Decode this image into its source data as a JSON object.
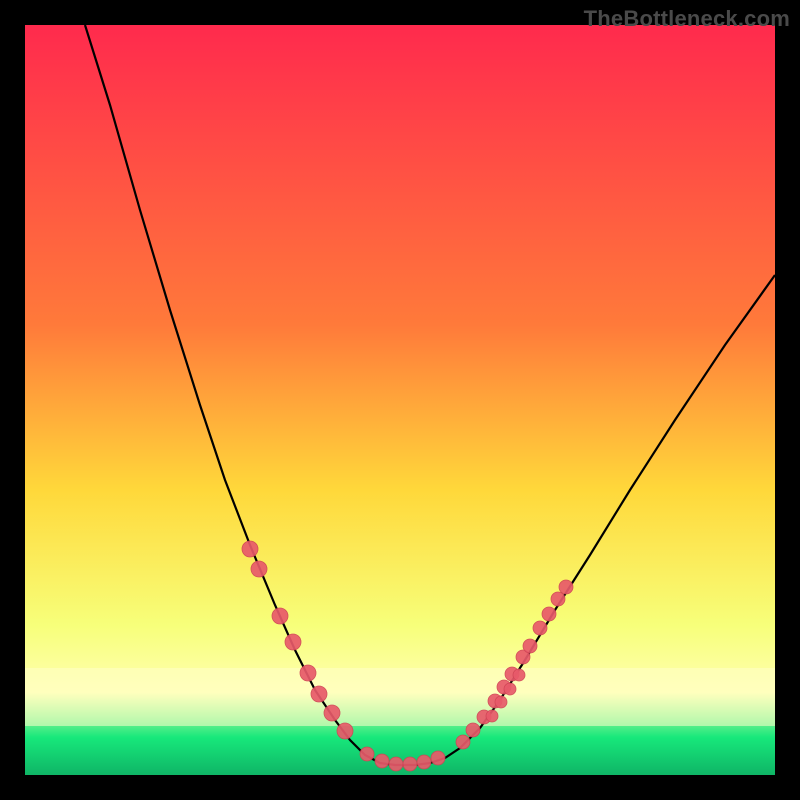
{
  "watermark": "TheBottleneck.com",
  "colors": {
    "gradient_top": "#ff2a4d",
    "gradient_upper_mid": "#ff7a3a",
    "gradient_mid": "#ffd83a",
    "gradient_lower_mid": "#f7ff7a",
    "gradient_pale_band": "#ffffb0",
    "gradient_bottom_green": "#17e87b",
    "gradient_bottom_green_dark": "#0fb566",
    "curve_stroke": "#000000",
    "marker_fill": "#e85a6a",
    "marker_stroke": "#d04455",
    "border": "#000000"
  },
  "chart_data": {
    "type": "line",
    "title": "",
    "xlabel": "",
    "ylabel": "",
    "xlim": [
      25,
      775
    ],
    "ylim": [
      775,
      25
    ],
    "curve": [
      {
        "x": 85,
        "y": 25
      },
      {
        "x": 110,
        "y": 105
      },
      {
        "x": 140,
        "y": 210
      },
      {
        "x": 170,
        "y": 310
      },
      {
        "x": 200,
        "y": 405
      },
      {
        "x": 225,
        "y": 480
      },
      {
        "x": 250,
        "y": 545
      },
      {
        "x": 275,
        "y": 605
      },
      {
        "x": 295,
        "y": 650
      },
      {
        "x": 315,
        "y": 690
      },
      {
        "x": 335,
        "y": 720
      },
      {
        "x": 350,
        "y": 740
      },
      {
        "x": 365,
        "y": 755
      },
      {
        "x": 380,
        "y": 763
      },
      {
        "x": 395,
        "y": 765
      },
      {
        "x": 415,
        "y": 765
      },
      {
        "x": 430,
        "y": 763
      },
      {
        "x": 445,
        "y": 758
      },
      {
        "x": 460,
        "y": 748
      },
      {
        "x": 480,
        "y": 728
      },
      {
        "x": 500,
        "y": 700
      },
      {
        "x": 525,
        "y": 660
      },
      {
        "x": 555,
        "y": 610
      },
      {
        "x": 590,
        "y": 555
      },
      {
        "x": 630,
        "y": 490
      },
      {
        "x": 675,
        "y": 420
      },
      {
        "x": 725,
        "y": 345
      },
      {
        "x": 775,
        "y": 275
      }
    ],
    "markers_left": [
      {
        "x": 250,
        "y": 549
      },
      {
        "x": 259,
        "y": 569
      },
      {
        "x": 280,
        "y": 616
      },
      {
        "x": 293,
        "y": 642
      },
      {
        "x": 308,
        "y": 673
      },
      {
        "x": 319,
        "y": 694
      },
      {
        "x": 332,
        "y": 713
      },
      {
        "x": 345,
        "y": 731
      }
    ],
    "markers_bottom": [
      {
        "x": 367,
        "y": 754
      },
      {
        "x": 382,
        "y": 761
      },
      {
        "x": 396,
        "y": 764
      },
      {
        "x": 410,
        "y": 764
      },
      {
        "x": 424,
        "y": 762
      },
      {
        "x": 438,
        "y": 758
      }
    ],
    "markers_right": [
      {
        "x": 463,
        "y": 742
      },
      {
        "x": 473,
        "y": 730
      },
      {
        "x": 484,
        "y": 717
      },
      {
        "x": 495,
        "y": 701
      },
      {
        "x": 504,
        "y": 687
      },
      {
        "x": 512,
        "y": 674
      },
      {
        "x": 523,
        "y": 657
      },
      {
        "x": 530,
        "y": 646
      },
      {
        "x": 540,
        "y": 628
      },
      {
        "x": 549,
        "y": 614
      },
      {
        "x": 558,
        "y": 599
      },
      {
        "x": 566,
        "y": 587
      }
    ],
    "markers_right_offset": [
      {
        "x": 492,
        "y": 716
      },
      {
        "x": 501,
        "y": 702
      },
      {
        "x": 510,
        "y": 689
      },
      {
        "x": 519,
        "y": 675
      }
    ]
  }
}
